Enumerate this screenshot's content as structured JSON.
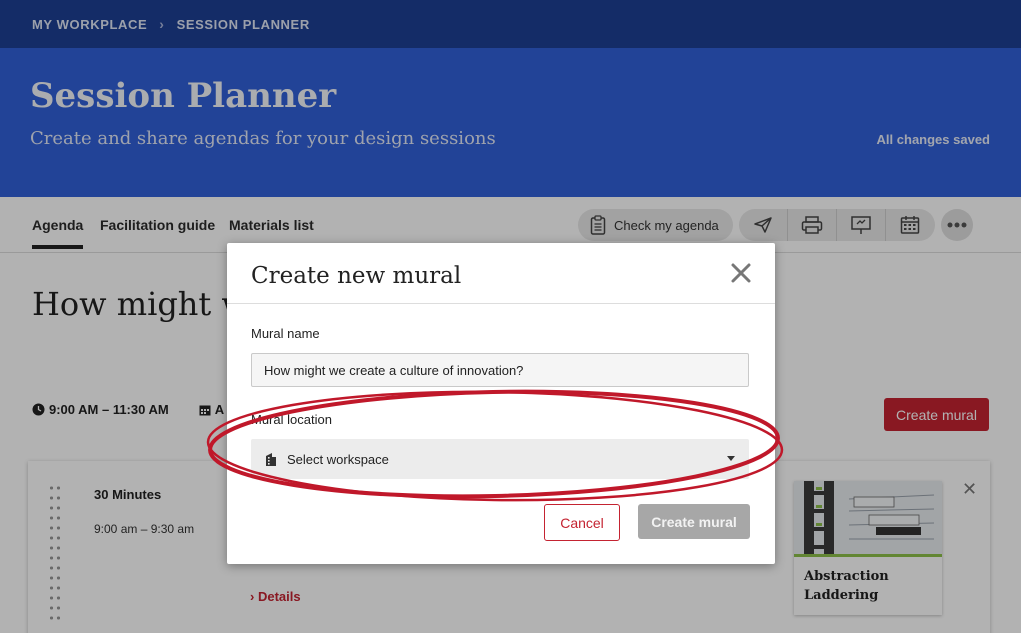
{
  "breadcrumb": {
    "items": [
      "MY WORKPLACE",
      "SESSION PLANNER"
    ]
  },
  "header": {
    "title": "Session Planner",
    "subtitle": "Create and share agendas for your design sessions",
    "status": "All changes saved"
  },
  "tabs": [
    "Agenda",
    "Facilitation guide",
    "Materials list"
  ],
  "toolbar": {
    "check_label": "Check my agenda",
    "icons": [
      "send-icon",
      "print-icon",
      "present-icon",
      "calendar-icon",
      "more-icon"
    ]
  },
  "agenda": {
    "title_visible": "How might we",
    "time_range": "9:00 AM – 11:30 AM",
    "date_partial": "A",
    "create_mural_label": "Create mural",
    "block": {
      "duration": "30 Minutes",
      "range": "9:00 am – 9:30 am",
      "details_label": "Details",
      "method_name": "Abstraction Laddering"
    }
  },
  "modal": {
    "title": "Create new mural",
    "name_label": "Mural name",
    "name_value": "How might we create a culture of innovation?",
    "location_label": "Mural location",
    "location_placeholder": "Select workspace",
    "cancel_label": "Cancel",
    "create_label": "Create mural"
  },
  "colors": {
    "brand_dark": "#1d4094",
    "brand": "#3160d8",
    "accent_red": "#c42331",
    "annotation": "#c0182a"
  }
}
